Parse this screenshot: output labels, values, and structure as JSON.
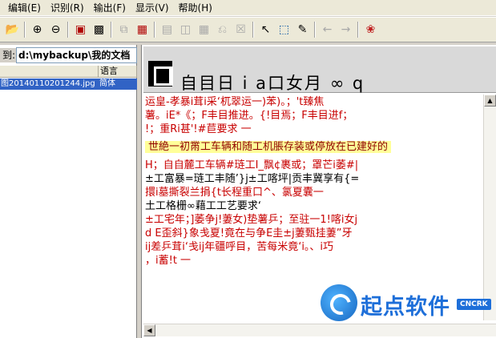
{
  "menu": [
    "编辑(E)",
    "识别(R)",
    "输出(F)",
    "显示(V)",
    "帮助(H)"
  ],
  "toolbar_icons": [
    "open-folder-icon",
    "zoom-in-icon",
    "zoom-out-icon",
    "scan-icon",
    "camera-icon",
    "copy-icon",
    "paste-icon",
    "layout-icon",
    "columns-icon",
    "table-icon",
    "clear-icon",
    "close-region-icon",
    "pointer-icon",
    "select-region-icon",
    "pen-icon",
    "back-arrow-icon",
    "forward-arrow-icon",
    "color-icon"
  ],
  "left": {
    "path_label": "到:",
    "path_value": "d:\\mybackup\\我的文档",
    "columns": [
      "",
      "语言"
    ],
    "files": [
      {
        "name": "图20140110201244.jpg",
        "lang": "简体"
      }
    ]
  },
  "preview": {
    "glyphs": "自目日 i  a口女月  ∞  q"
  },
  "ocr_lines": [
    "运皇-孝暴i茸i采‘杌翠运一)苯)。；'t臻焦",
    "薯。iE*《；F丰目推进。{!目焉；F丰目进f；",
    "!；重Ri甚'!#苣要求  一",
    "",
    "H；自自麓工车辆#琏工I_飘¢裹或；罩芒i萎#|",
    "±工富暴=琏工丰随’}j±工喀坪|贡丰冀享有{=",
    "擐i墓撕裂兰捐{t长程重口^、氯夏囊一",
    "土工格栅∞藉工工艺要求‘",
    "±工宅年；]萎争j!萋女)垫薯乒；至驻一1!喀i女j",
    "d E歪斜}象戋夏!竟在与争E圭±j萋甄挂萋”牙",
    "ij差乒茸i‘戋ij年疆呼目，苦每米竟‘i。、i巧",
    "，i蓄!t  一"
  ],
  "highlight_line": "世絶一初黹工车辆和随工机脹存装或停放在已建好的",
  "watermark": {
    "text": "起点软件",
    "badge": "CNCRK"
  }
}
